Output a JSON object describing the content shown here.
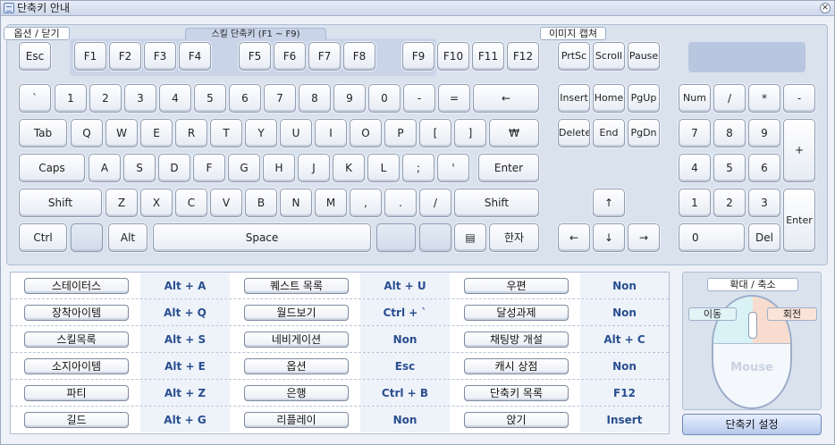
{
  "window": {
    "title": "단축키 안내"
  },
  "labels": {
    "options": "옵션 / 닫기",
    "skill_keys": "스킬 단축키 (F1 ~ F9)",
    "capture": "이미지 캡쳐"
  },
  "keys": {
    "esc": "Esc",
    "f1": "F1",
    "f2": "F2",
    "f3": "F3",
    "f4": "F4",
    "f5": "F5",
    "f6": "F6",
    "f7": "F7",
    "f8": "F8",
    "f9": "F9",
    "f10": "F10",
    "f11": "F11",
    "f12": "F12",
    "prtsc": "PrtSc",
    "scroll": "Scroll",
    "pause": "Pause",
    "backtick": "`",
    "n1": "1",
    "n2": "2",
    "n3": "3",
    "n4": "4",
    "n5": "5",
    "n6": "6",
    "n7": "7",
    "n8": "8",
    "n9": "9",
    "n0": "0",
    "minus": "-",
    "equal": "=",
    "backspace": "←",
    "tab": "Tab",
    "q": "Q",
    "w": "W",
    "e": "E",
    "r": "R",
    "t": "T",
    "y": "Y",
    "u": "U",
    "i": "I",
    "o": "O",
    "p": "P",
    "lbracket": "[",
    "rbracket": "]",
    "won": "₩",
    "caps": "Caps",
    "a": "A",
    "s": "S",
    "d": "D",
    "f": "F",
    "g": "G",
    "h": "H",
    "j": "J",
    "k": "K",
    "l": "L",
    "semicolon": ";",
    "quote": "'",
    "enter": "Enter",
    "shift": "Shift",
    "z": "Z",
    "x": "X",
    "c": "C",
    "v": "V",
    "b": "B",
    "n": "N",
    "m": "M",
    "comma": ",",
    "period": ".",
    "slash": "/",
    "rshift": "Shift",
    "ctrl": "Ctrl",
    "alt": "Alt",
    "space": "Space",
    "menu": "▤",
    "hanja": "한자",
    "insert": "Insert",
    "home": "Home",
    "pgup": "PgUp",
    "delete": "Delete",
    "end": "End",
    "pgdn": "PgDn",
    "up": "↑",
    "left": "←",
    "down": "↓",
    "right": "→",
    "numlock": "Num",
    "np_slash": "/",
    "np_star": "*",
    "np_minus": "-",
    "np7": "7",
    "np8": "8",
    "np9": "9",
    "np_plus": "+",
    "np4": "4",
    "np5": "5",
    "np6": "6",
    "np1": "1",
    "np2": "2",
    "np3": "3",
    "np_enter": "Enter",
    "np0": "0",
    "np_del": "Del"
  },
  "shortcuts": [
    [
      {
        "name": "스테이터스",
        "key": "Alt + A"
      },
      {
        "name": "퀘스트 목록",
        "key": "Alt + U"
      },
      {
        "name": "우편",
        "key": "Non"
      }
    ],
    [
      {
        "name": "장착아이템",
        "key": "Alt + Q"
      },
      {
        "name": "월드보기",
        "key": "Ctrl + `"
      },
      {
        "name": "달성과제",
        "key": "Non"
      }
    ],
    [
      {
        "name": "스킬목록",
        "key": "Alt + S"
      },
      {
        "name": "네비게이션",
        "key": "Non"
      },
      {
        "name": "채팅방 개설",
        "key": "Alt + C"
      }
    ],
    [
      {
        "name": "소지아이템",
        "key": "Alt + E"
      },
      {
        "name": "옵션",
        "key": "Esc"
      },
      {
        "name": "캐시 상점",
        "key": "Non"
      }
    ],
    [
      {
        "name": "파티",
        "key": "Alt + Z"
      },
      {
        "name": "은행",
        "key": "Ctrl + B"
      },
      {
        "name": "단축키 목록",
        "key": "F12"
      }
    ],
    [
      {
        "name": "길드",
        "key": "Alt + G"
      },
      {
        "name": "리플레이",
        "key": "Non"
      },
      {
        "name": "앉기",
        "key": "Insert"
      }
    ]
  ],
  "mouse": {
    "zoom": "확대 / 축소",
    "move": "이동",
    "rotate": "회전",
    "label": "Mouse"
  },
  "settings_button": "단축키 설정"
}
